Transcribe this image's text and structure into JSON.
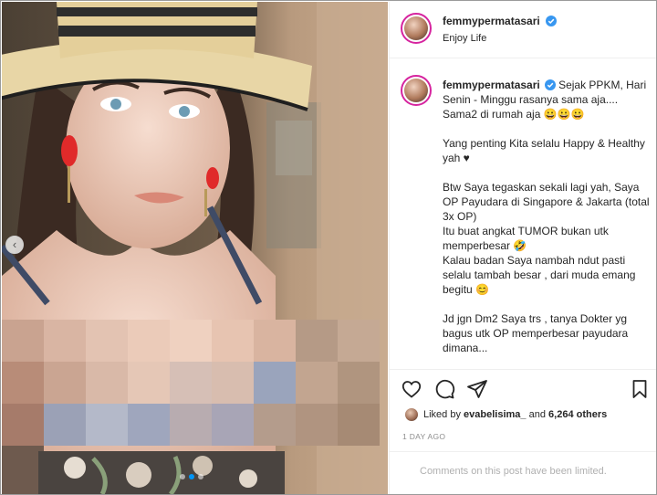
{
  "post": {
    "username": "femmypermatasari",
    "verified": true,
    "location": "Enjoy Life",
    "caption_first": "Sejak PPKM, Hari Senin - Minggu rasanya sama aja....",
    "caption_lines": [
      "Sama2 di rumah aja 😀😀😀",
      "",
      "Yang penting Kita selalu Happy & Healthy yah ♥",
      "",
      "Btw Saya tegaskan sekali lagi yah, Saya OP Payudara di Singapore & Jakarta (total 3x OP)",
      "Itu buat angkat TUMOR bukan utk memperbesar 🤣",
      "Kalau badan Saya nambah ndut pasti selalu tambah besar , dari muda emang begitu 😊",
      "",
      "Jd jgn Dm2 Saya trs , tanya Dokter yg bagus utk OP memperbesar payudara dimana..."
    ],
    "likes": {
      "prefix": "Liked by",
      "user": "evabelisima_",
      "connector": "and",
      "others": "6,264 others"
    },
    "time_ago": "1 DAY AGO",
    "comments_limited": "Comments on this post have been limited."
  },
  "icons": {
    "like": "heart-outline-icon",
    "comment": "comment-bubble-icon",
    "share": "paper-plane-icon",
    "save": "bookmark-outline-icon",
    "verified": "verified-badge-icon",
    "carousel_prev": "chevron-left-icon"
  },
  "colors": {
    "verified": "#3897f0",
    "story_ring": "#d6249f",
    "active_dot": "#0095f6",
    "muted_text": "#8e8e8e"
  },
  "carousel": {
    "current": 2,
    "total": 3
  }
}
